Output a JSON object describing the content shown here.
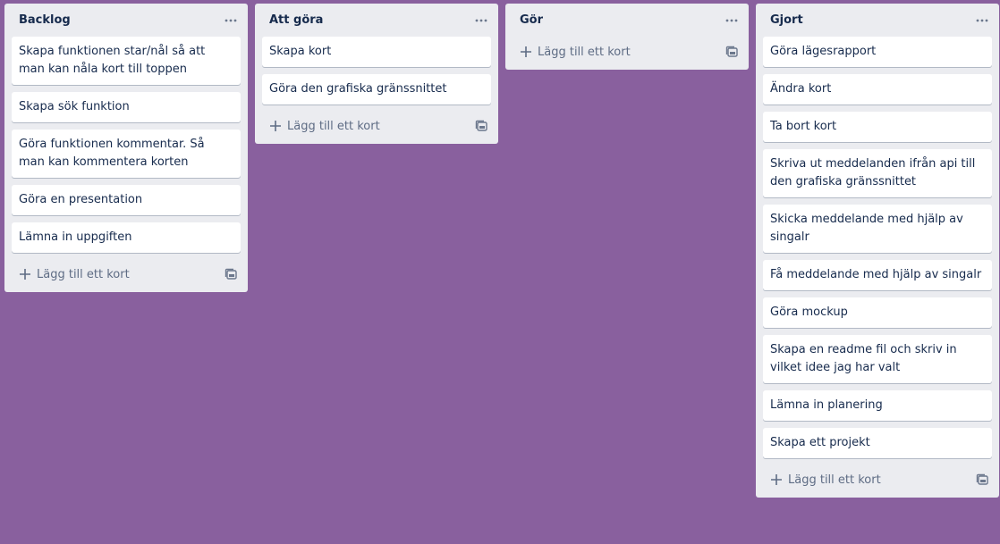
{
  "colors": {
    "board_background": "#89609e",
    "list_background": "#ebecf0",
    "card_background": "#ffffff",
    "text": "#172b4d",
    "muted_text": "#5e6c84"
  },
  "icons": {
    "list_menu": "more-horizontal-icon",
    "add": "plus-icon",
    "template": "card-template-icon"
  },
  "lists": [
    {
      "title": "Backlog",
      "add_card_label": "Lägg till ett kort",
      "cards": [
        "Skapa funktionen star/nål så att man kan nåla kort till toppen",
        "Skapa sök funktion",
        "Göra funktionen kommentar. Så man kan kommentera korten",
        "Göra en presentation",
        "Lämna in uppgiften"
      ]
    },
    {
      "title": "Att göra",
      "add_card_label": "Lägg till ett kort",
      "cards": [
        "Skapa kort",
        "Göra den grafiska gränssnittet"
      ]
    },
    {
      "title": "Gör",
      "add_card_label": "Lägg till ett kort",
      "cards": []
    },
    {
      "title": "Gjort",
      "add_card_label": "Lägg till ett kort",
      "cards": [
        "Göra lägesrapport",
        "Ändra kort",
        "Ta bort kort",
        "Skriva ut meddelanden ifrån api till den grafiska gränssnittet",
        "Skicka meddelande med hjälp av singalr",
        "Få meddelande med hjälp av singalr",
        "Göra mockup",
        "Skapa en readme fil och skriv in vilket idee jag har valt",
        "Lämna in planering",
        "Skapa ett projekt"
      ]
    }
  ]
}
